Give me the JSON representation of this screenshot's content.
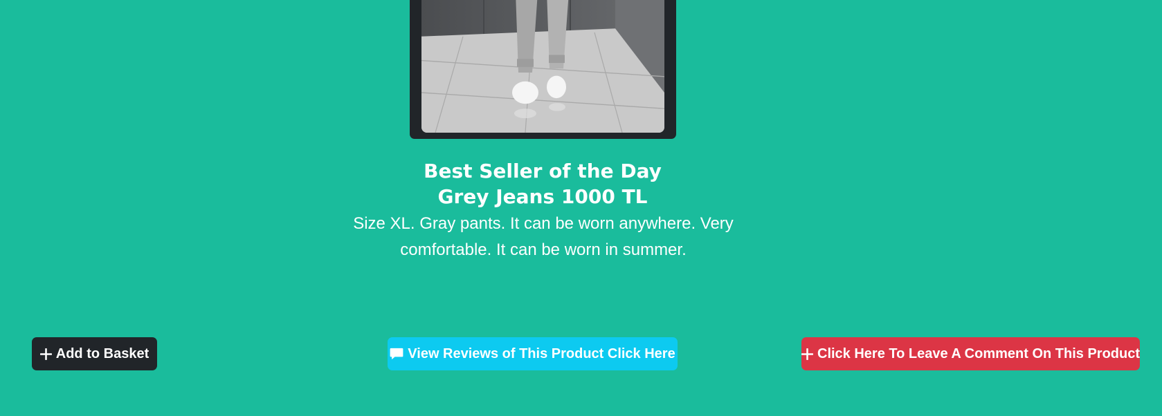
{
  "product": {
    "image_alt": "Grey jeans with white sneakers",
    "heading_line1": "Best Seller of the Day",
    "heading_line2": "Grey Jeans 1000 TL",
    "description": "Size XL. Gray pants. It can be worn anywhere. Very comfortable. It can be worn in summer."
  },
  "actions": {
    "add_to_basket": {
      "label": "Add to Basket",
      "icon": "plus-icon"
    },
    "view_reviews": {
      "label": "View Reviews of This Product Click Here",
      "icon": "chat-bubble-icon"
    },
    "leave_comment": {
      "label": "Click Here To Leave A Comment On This Product",
      "icon": "plus-icon"
    }
  },
  "colors": {
    "background": "#1abc9c",
    "dark": "#212529",
    "info": "#0dcaf0",
    "danger": "#dc3545",
    "text": "#ffffff"
  }
}
